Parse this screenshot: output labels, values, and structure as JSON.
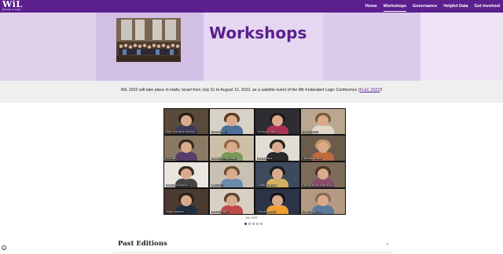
{
  "header": {
    "logo_text": "WiL",
    "logo_subtext": "Women in Logic",
    "nav": [
      {
        "label": "Home",
        "active": false
      },
      {
        "label": "Workshops",
        "active": true
      },
      {
        "label": "Governance",
        "active": false
      },
      {
        "label": "Helpful Data",
        "active": false
      },
      {
        "label": "Get Involved",
        "active": false
      }
    ]
  },
  "hero": {
    "title": "Workshops",
    "photo_icon": "group-photo"
  },
  "announcement": {
    "text_before": "WiL 2022 will take place in Haifa, Israel from July 31 to August 12, 2022, as a satellite event of the 8th Federated Logic Conference (",
    "link": "FLoC 2022",
    "text_after": ")!"
  },
  "gallery": {
    "caption": "WiL 2022",
    "slide_count": 5,
    "active_slide": 1,
    "participants": [
      "Sara Jo Rothman (she/her)",
      "Sandra Alves",
      "Temiloyase Pekoe",
      "Sandra Alves",
      "Amy Felty",
      "Kirsten van Rosenstiel",
      "Ana Sokolova",
      "Jana Wagemaker",
      "Sadie Hirst Freeman",
      "Ellen Hoy",
      "Amalia Hadjimedi",
      "Simona Ronchi Della Rocca",
      "Paola Calabrese",
      "Mahsa Ivrindar",
      "Daniela Petrisan",
      "Claire Tabary Ott"
    ]
  },
  "past_editions": {
    "title": "Past Editions",
    "chevron_icon": "chevron-down-icon"
  },
  "colors": {
    "brand": "#5b1f8e"
  }
}
